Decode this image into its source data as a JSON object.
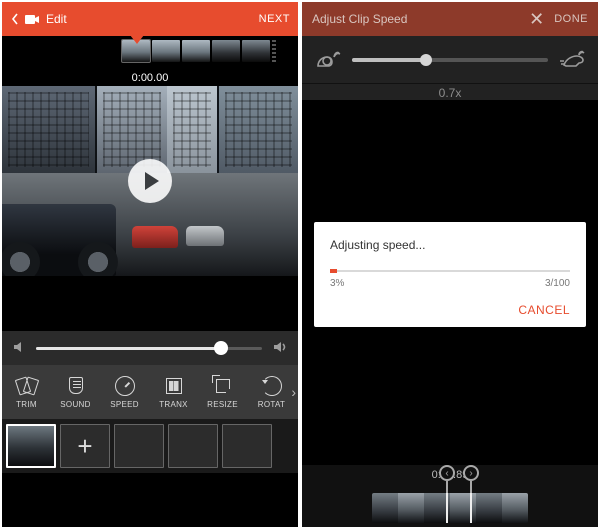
{
  "left": {
    "header": {
      "title": "Edit",
      "next": "NEXT"
    },
    "timecode": "0:00.00",
    "volume": {
      "percent": 82
    },
    "tools": [
      {
        "id": "trim",
        "label": "TRIM"
      },
      {
        "id": "sound",
        "label": "SOUND"
      },
      {
        "id": "speed",
        "label": "SPEED"
      },
      {
        "id": "tranx",
        "label": "TRANX"
      },
      {
        "id": "resize",
        "label": "RESIZE"
      },
      {
        "id": "rotate",
        "label": "ROTAT"
      }
    ],
    "clip_slots": 5,
    "selected_clip": 0
  },
  "right": {
    "header": {
      "title": "Adjust Clip Speed",
      "done": "DONE"
    },
    "slider": {
      "value_label": "0.7x",
      "percent": 38
    },
    "dialog": {
      "title": "Adjusting speed...",
      "percent_label": "3%",
      "count_label": "3/100",
      "percent": 3,
      "cancel": "CANCEL"
    },
    "timecode": "0:32.89"
  },
  "colors": {
    "accent": "#e74c2e"
  }
}
